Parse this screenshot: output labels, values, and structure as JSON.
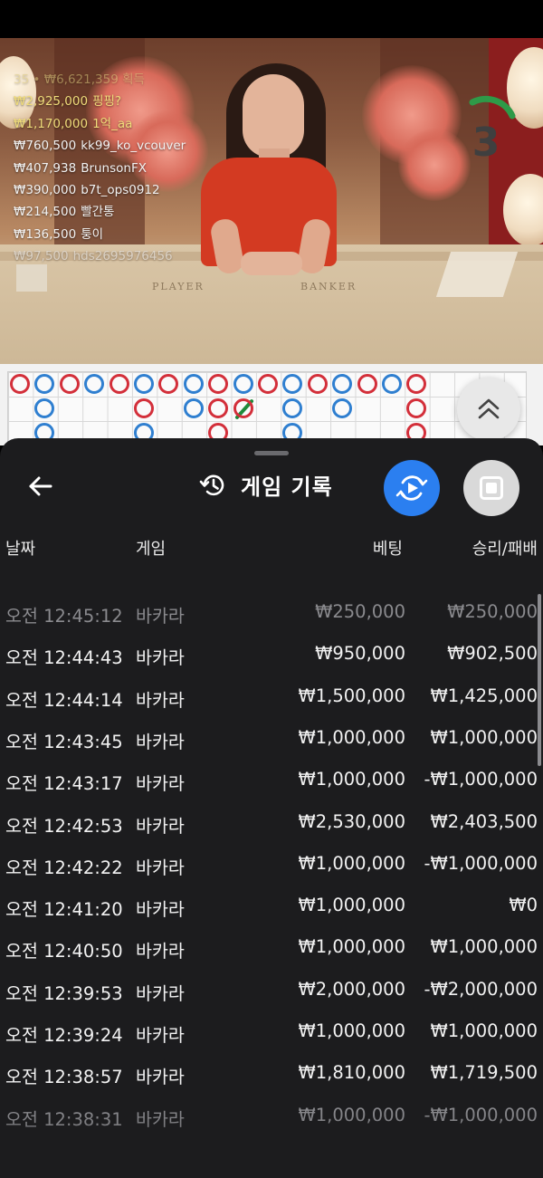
{
  "colors": {
    "accent_blue": "#2b7ff0",
    "banker_red": "#d32f3a",
    "player_blue": "#2f7fd0",
    "tie_green": "#1f8a3a",
    "sheet_bg": "#1c1c1e",
    "ticker_gold": "#e6d27a"
  },
  "video": {
    "table_label_player": "PLAYER",
    "table_label_banker": "BANKER",
    "countdown": "3",
    "ticker_header": "35 • ₩6,621,359 획득",
    "ticker": [
      {
        "amount": "₩2,925,000",
        "name": "핑핑?",
        "color": "#f0dc7a"
      },
      {
        "amount": "₩1,170,000",
        "name": "1억_aa",
        "color": "#f0dc7a"
      },
      {
        "amount": "₩760,500",
        "name": "kk99_ko_vcouver",
        "color": "#f2f2f2"
      },
      {
        "amount": "₩407,938",
        "name": "BrunsonFX",
        "color": "#f2f2f2"
      },
      {
        "amount": "₩390,000",
        "name": "b7t_ops0912",
        "color": "#f2f2f2"
      },
      {
        "amount": "₩214,500",
        "name": "빨간통",
        "color": "#f2f2f2"
      },
      {
        "amount": "₩136,500",
        "name": "퉁이",
        "color": "#f2f2f2"
      },
      {
        "amount": "₩97,500",
        "name": "hds2695976456",
        "color": "#e6e6e6"
      }
    ]
  },
  "roadmap": {
    "icon": "chevron-double-up-icon"
  },
  "history": {
    "title": "게임 기록",
    "icons": {
      "back": "arrow-left-icon",
      "title": "history-clock-icon",
      "replay": "replay-video-icon",
      "stop": "stop-icon"
    },
    "columns": {
      "date": "날짜",
      "game": "게임",
      "bet": "베팅",
      "result": "승리/패배"
    },
    "rows": [
      {
        "time": "오전 12:45:12",
        "game": "바카라",
        "bet": "₩250,000",
        "result": "₩250,000"
      },
      {
        "time": "오전 12:44:43",
        "game": "바카라",
        "bet": "₩950,000",
        "result": "₩902,500"
      },
      {
        "time": "오전 12:44:14",
        "game": "바카라",
        "bet": "₩1,500,000",
        "result": "₩1,425,000"
      },
      {
        "time": "오전 12:43:45",
        "game": "바카라",
        "bet": "₩1,000,000",
        "result": "₩1,000,000"
      },
      {
        "time": "오전 12:43:17",
        "game": "바카라",
        "bet": "₩1,000,000",
        "result": "-₩1,000,000"
      },
      {
        "time": "오전 12:42:53",
        "game": "바카라",
        "bet": "₩2,530,000",
        "result": "₩2,403,500"
      },
      {
        "time": "오전 12:42:22",
        "game": "바카라",
        "bet": "₩1,000,000",
        "result": "-₩1,000,000"
      },
      {
        "time": "오전 12:41:20",
        "game": "바카라",
        "bet": "₩1,000,000",
        "result": "₩0"
      },
      {
        "time": "오전 12:40:50",
        "game": "바카라",
        "bet": "₩1,000,000",
        "result": "₩1,000,000"
      },
      {
        "time": "오전 12:39:53",
        "game": "바카라",
        "bet": "₩2,000,000",
        "result": "-₩2,000,000"
      },
      {
        "time": "오전 12:39:24",
        "game": "바카라",
        "bet": "₩1,000,000",
        "result": "₩1,000,000"
      },
      {
        "time": "오전 12:38:57",
        "game": "바카라",
        "bet": "₩1,810,000",
        "result": "₩1,719,500"
      },
      {
        "time": "오전 12:38:31",
        "game": "바카라",
        "bet": "₩1,000,000",
        "result": "-₩1,000,000"
      }
    ]
  }
}
